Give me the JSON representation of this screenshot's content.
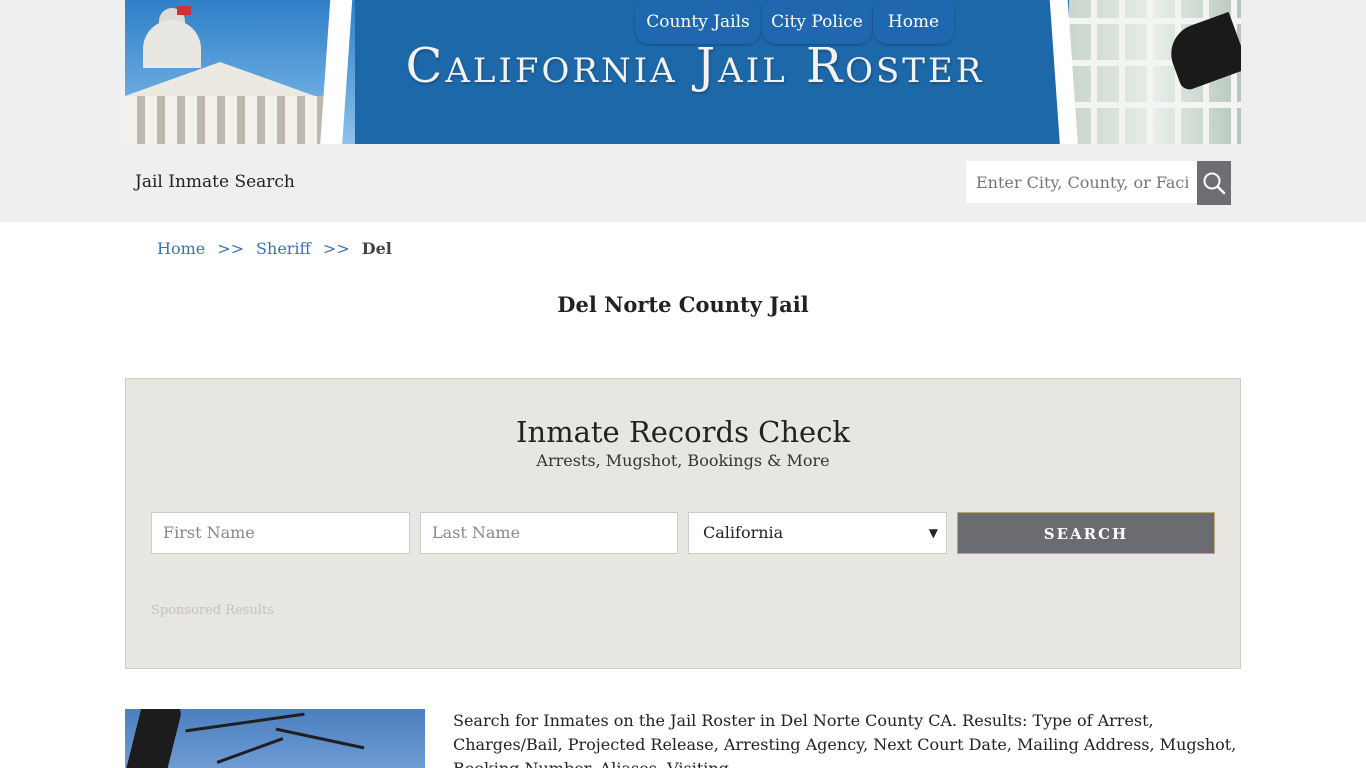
{
  "header": {
    "banner_title": "California Jail Roster",
    "site_name": "Jail Inmate Search",
    "nav": [
      "County Jails",
      "City Police",
      "Home"
    ],
    "search_placeholder": "Enter City, County, or Facility",
    "search_icon": "search-icon"
  },
  "breadcrumb": {
    "items": [
      "Home",
      "Sheriff"
    ],
    "separator": ">>",
    "current": "Del"
  },
  "page": {
    "title": "Del Norte County Jail"
  },
  "records_check": {
    "title": "Inmate Records Check",
    "subtitle": "Arrests, Mugshot, Bookings & More",
    "first_name_placeholder": "First Name",
    "last_name_placeholder": "Last Name",
    "state_selected": "California",
    "search_label": "SEARCH",
    "sponsored": "Sponsored Results"
  },
  "content": {
    "description": "Search for Inmates on the Jail Roster in Del Norte County CA. Results: Type of Arrest, Charges/Bail, Projected Release, Arresting Agency, Next Court Date, Mailing Address, Mugshot, Booking Number, Aliases, Visiting"
  },
  "colors": {
    "brand_blue": "#1f68b0",
    "link_blue": "#3a73b8",
    "panel_bg": "#e8e6e1",
    "button_gray": "#6a6c72"
  }
}
